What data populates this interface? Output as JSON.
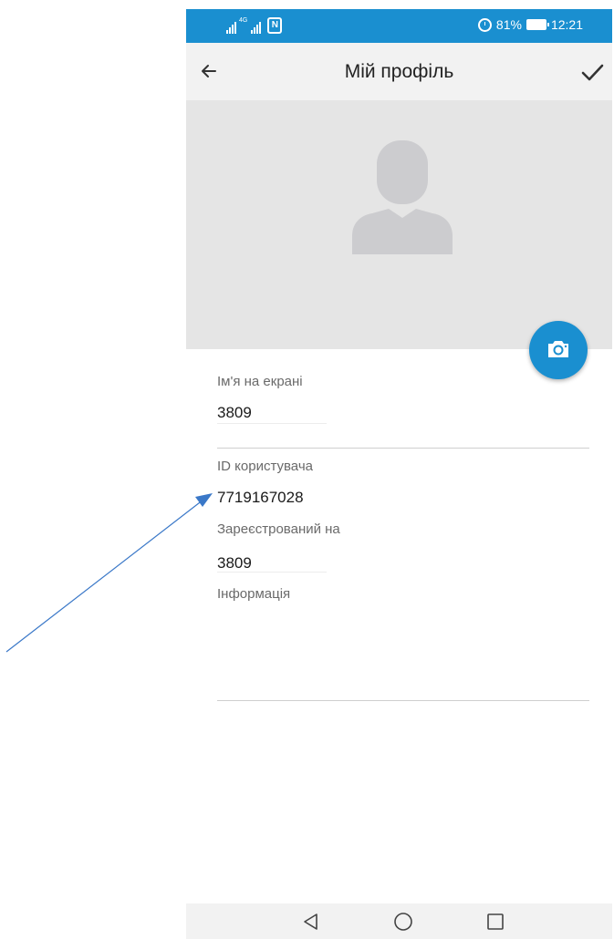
{
  "status_bar": {
    "network_label": "4G",
    "battery_percent": "81%",
    "time": "12:21",
    "nfc_label": "N",
    "icons": [
      "signal-icon",
      "nfc-icon",
      "alarm-icon",
      "battery-icon"
    ]
  },
  "app_bar": {
    "title": "Мій профіль",
    "back_icon": "arrow-left-icon",
    "confirm_icon": "checkmark-icon"
  },
  "profile": {
    "avatar_icon": "person-placeholder-icon",
    "camera_icon": "camera-icon"
  },
  "fields": {
    "display_name_label": "Ім'я на екрані",
    "display_name_value": "3809",
    "user_id_label": "ID користувача",
    "user_id_value": "7719167028",
    "registered_label": "Зареєстрований на",
    "registered_value": "3809",
    "info_label": "Інформація"
  },
  "nav_bar": {
    "icons": [
      "back-triangle-icon",
      "home-circle-icon",
      "recents-square-icon"
    ]
  },
  "colors": {
    "accent": "#1a8fd0",
    "app_bar_bg": "#f2f2f2",
    "avatar_bg": "#e5e5e5",
    "annotation_arrow": "#3a78c8"
  }
}
